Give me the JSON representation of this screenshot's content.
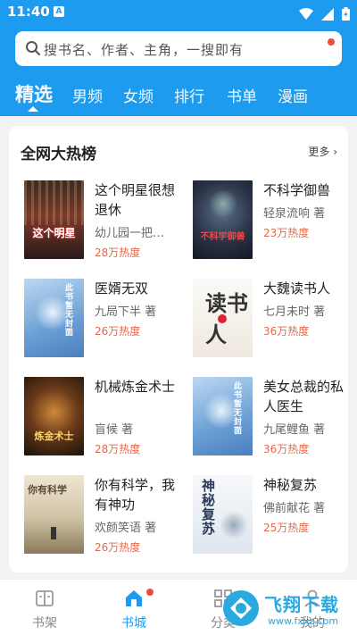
{
  "status": {
    "time": "11:40",
    "notif": "A"
  },
  "search": {
    "placeholder": "搜书名、作者、主角，一搜即有"
  },
  "tabs": [
    {
      "label": "精选"
    },
    {
      "label": "男频"
    },
    {
      "label": "女频"
    },
    {
      "label": "排行"
    },
    {
      "label": "书单"
    },
    {
      "label": "漫画"
    }
  ],
  "section": {
    "title": "全网大热榜",
    "more": "更多 ›"
  },
  "books": [
    {
      "title": "这个明星很想退休",
      "author": "幼儿园一把…",
      "heat": "28万热度",
      "cover_text": "这个明星"
    },
    {
      "title": "不科学御兽",
      "author": "轻泉流响 著",
      "heat": "23万热度",
      "cover_text": "不科学御兽"
    },
    {
      "title": "医婿无双",
      "author": "九局下半 著",
      "heat": "26万热度",
      "cover_text": "此书暂无封面"
    },
    {
      "title": "大魏读书人",
      "author": "七月未时 著",
      "heat": "36万热度",
      "cover_text": "读书人"
    },
    {
      "title": "机械炼金术士",
      "author": "盲候 著",
      "heat": "28万热度",
      "cover_text": "炼金术士"
    },
    {
      "title": "美女总裁的私人医生",
      "author": "九尾鲤鱼 著",
      "heat": "36万热度",
      "cover_text": "此书暂无封面"
    },
    {
      "title": "你有科学，我有神功",
      "author": "欢颜笑语 著",
      "heat": "26万热度",
      "cover_text": "你有科学"
    },
    {
      "title": "神秘复苏",
      "author": "佛前献花 著",
      "heat": "25万热度",
      "cover_text": "神秘复苏"
    }
  ],
  "nav": [
    {
      "label": "书架",
      "icon": "bookshelf-icon"
    },
    {
      "label": "书城",
      "icon": "store-icon"
    },
    {
      "label": "分类",
      "icon": "category-icon"
    },
    {
      "label": "我的",
      "icon": "profile-icon"
    }
  ],
  "watermark": {
    "text": "飞翔下载",
    "url_text": "www.fxxz.com"
  },
  "colors": {
    "primary": "#1d9bef",
    "heat": "#e26a4b",
    "dot": "#f04a3a"
  }
}
